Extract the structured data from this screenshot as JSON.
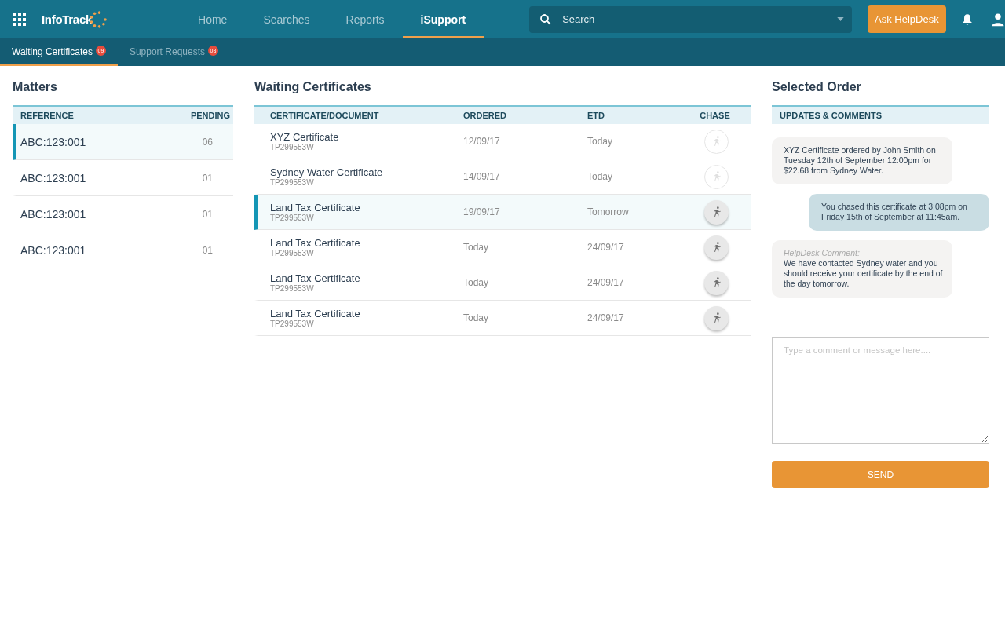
{
  "header": {
    "logo": "InfoTrack",
    "nav": [
      {
        "label": "Home",
        "selected": false
      },
      {
        "label": "Searches",
        "selected": false
      },
      {
        "label": "Reports",
        "selected": false
      },
      {
        "label": "iSupport",
        "selected": true
      }
    ],
    "search": {
      "placeholder": "Search"
    },
    "helpdesk_button": "Ask HelpDesk"
  },
  "subtabs": [
    {
      "label": "Waiting Certificates",
      "badge": "09",
      "selected": true
    },
    {
      "label": "Support Requests",
      "badge": "03",
      "selected": false
    }
  ],
  "matters": {
    "title": "Matters",
    "columns": [
      "REFERENCE",
      "PENDING"
    ],
    "rows": [
      {
        "reference": "ABC:123:001",
        "pending": "06",
        "selected": true
      },
      {
        "reference": "ABC:123:001",
        "pending": "01",
        "selected": false
      },
      {
        "reference": "ABC:123:001",
        "pending": "01",
        "selected": false
      },
      {
        "reference": "ABC:123:001",
        "pending": "01",
        "selected": false
      }
    ]
  },
  "certificates": {
    "title": "Waiting Certificates",
    "columns": [
      "CERTIFICATE/DOCUMENT",
      "ORDERED",
      "ETD",
      "CHASE"
    ],
    "rows": [
      {
        "name": "XYZ Certificate",
        "code": "TP299553W",
        "ordered": "12/09/17",
        "etd": "Today",
        "selected": false,
        "chase_disabled": true
      },
      {
        "name": "Sydney Water Certificate",
        "code": "TP299553W",
        "ordered": "14/09/17",
        "etd": "Today",
        "selected": false,
        "chase_disabled": true
      },
      {
        "name": "Land Tax Certificate",
        "code": "TP299553W",
        "ordered": "19/09/17",
        "etd": "Tomorrow",
        "selected": true,
        "chase_disabled": false
      },
      {
        "name": "Land Tax Certificate",
        "code": "TP299553W",
        "ordered": "Today",
        "etd": "24/09/17",
        "selected": false,
        "chase_disabled": false
      },
      {
        "name": "Land Tax Certificate",
        "code": "TP299553W",
        "ordered": "Today",
        "etd": "24/09/17",
        "selected": false,
        "chase_disabled": false
      },
      {
        "name": "Land Tax Certificate",
        "code": "TP299553W",
        "ordered": "Today",
        "etd": "24/09/17",
        "selected": false,
        "chase_disabled": false
      }
    ]
  },
  "selected_order": {
    "title": "Selected Order",
    "section": "UPDATES & COMMENTS",
    "messages": [
      {
        "kind": "update",
        "text": "XYZ Certificate ordered by John Smith on Tuesday 12th of September 12:00pm for $22.68 from Sydney Water."
      },
      {
        "kind": "chase",
        "text": "You chased this certificate at 3:08pm on Friday 15th of September at 11:45am."
      },
      {
        "kind": "helpdesk",
        "label": "HelpDesk Comment:",
        "text": "We have contacted Sydney water and you should receive your certificate by the end of the day tomorrow."
      }
    ],
    "comment": {
      "placeholder": "Type a comment or message here...."
    },
    "send_button": "SEND"
  }
}
